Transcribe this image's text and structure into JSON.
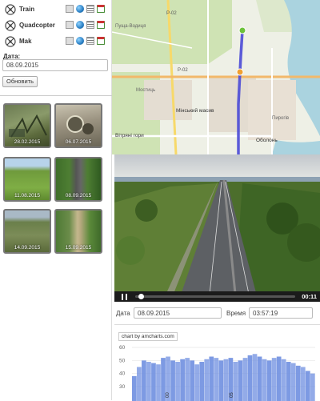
{
  "drones": [
    {
      "name": "Train"
    },
    {
      "name": "Quadcopter"
    },
    {
      "name": "Mak"
    }
  ],
  "date_panel": {
    "label": "Дата:",
    "value": "08.09.2015",
    "refresh_label": "Обновить"
  },
  "thumbnails": [
    {
      "date": "28.02.2015"
    },
    {
      "date": "06.07.2015"
    },
    {
      "date": "11.08.2015"
    },
    {
      "date": "08.09.2015"
    },
    {
      "date": "14.09.2015"
    },
    {
      "date": "15.09.2015"
    }
  ],
  "map": {
    "labels": {
      "road1": "Р-02",
      "road2": "Р-02",
      "district1": "Мінський масив",
      "district2": "Оболонь",
      "district3": "Вітряні гори",
      "district4": "Пуща-Водиця",
      "place1": "Пирогів",
      "place2": "Мостиць"
    }
  },
  "video": {
    "time": "00:11",
    "progress": 0.02
  },
  "info_bar": {
    "date_label": "Дата",
    "date_value": "08.09.2015",
    "time_label": "Время",
    "time_value": "03:57:19"
  },
  "chart": {
    "credit": "chart by amcharts.com"
  },
  "chart_data": {
    "type": "area",
    "y_ticks": [
      "60",
      "50",
      "40",
      "30"
    ],
    "ylim": [
      25,
      65
    ],
    "color": "#6f8fe0",
    "series": [
      {
        "values": [
          38,
          45,
          50,
          49,
          48,
          47,
          52,
          53,
          50,
          49,
          51,
          52,
          50,
          47,
          49,
          51,
          53,
          52,
          50,
          51,
          52,
          49,
          50,
          52,
          54,
          55,
          53,
          51,
          50,
          52,
          53,
          51,
          49,
          48,
          46,
          45,
          42,
          40
        ]
      }
    ],
    "marker_labels": [
      "00",
      "05"
    ]
  },
  "colors": {
    "route": "#4a4ad6",
    "marker_start": "#6cc23a",
    "marker_current": "#f0a030"
  }
}
